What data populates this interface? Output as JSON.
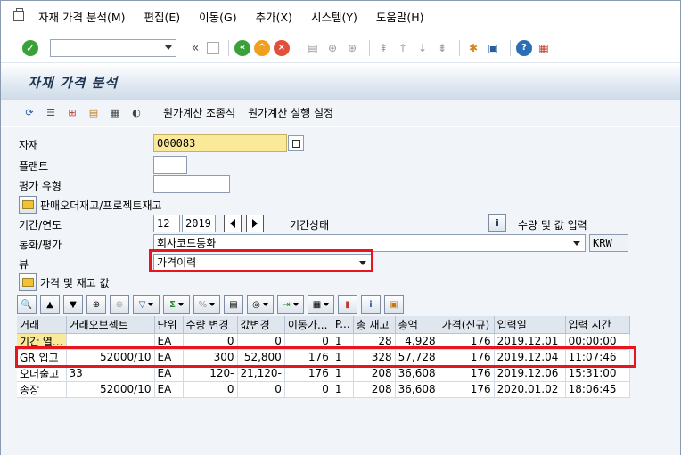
{
  "menu": [
    "자재 가격 분석(M)",
    "편집(E)",
    "이동(G)",
    "추가(X)",
    "시스템(Y)",
    "도움말(H)"
  ],
  "title": "자재 가격 분석",
  "app_toolbar": {
    "cost_view": "원가계산 조종석",
    "cost_settings": "원가계산 실행 설정"
  },
  "form": {
    "material_label": "자재",
    "material_value": "000083",
    "plant_label": "플랜트",
    "plant_value": "",
    "valuation_type_label": "평가 유형",
    "valuation_type_value": "",
    "sales_order_stock_label": "판매오더재고/프로젝트재고",
    "period_label": "기간/연도",
    "period_value": "12",
    "year_value": "2019",
    "period_status_label": "기간상태",
    "qty_value_input_label": "수량 및 값 입력",
    "currency_label": "통화/평가",
    "currency_value": "회사코드통화",
    "currency_code": "KRW",
    "view_label": "뷰",
    "view_value": "가격이력",
    "price_stock_values_label": "가격 및 재고 값"
  },
  "table": {
    "headers": [
      "거래",
      "거래오브젝트",
      "단위",
      "수량 변경",
      "값변경",
      "이동가...",
      "P...",
      "총 재고",
      "총액",
      "가격(신규)",
      "입력일",
      "입력 시간"
    ],
    "rows": [
      [
        "기간 열...",
        "",
        "EA",
        "0",
        "0",
        "0",
        "1",
        "28",
        "4,928",
        "176",
        "2019.12.01",
        "00:00:00"
      ],
      [
        "GR 입고",
        "52000/10",
        "EA",
        "300",
        "52,800",
        "176",
        "1",
        "328",
        "57,728",
        "176",
        "2019.12.04",
        "11:07:46"
      ],
      [
        "오더출고",
        "33",
        "EA",
        "120-",
        "21,120-",
        "176",
        "1",
        "208",
        "36,608",
        "176",
        "2019.12.06",
        "15:31:00"
      ],
      [
        "송장",
        "52000/10",
        "EA",
        "0",
        "0",
        "0",
        "1",
        "208",
        "36,608",
        "176",
        "2020.01.02",
        "18:06:45"
      ]
    ]
  },
  "colors": {
    "highlight": "#e8141e",
    "required_field": "#fbe99a",
    "background": "#f1f5f9"
  }
}
